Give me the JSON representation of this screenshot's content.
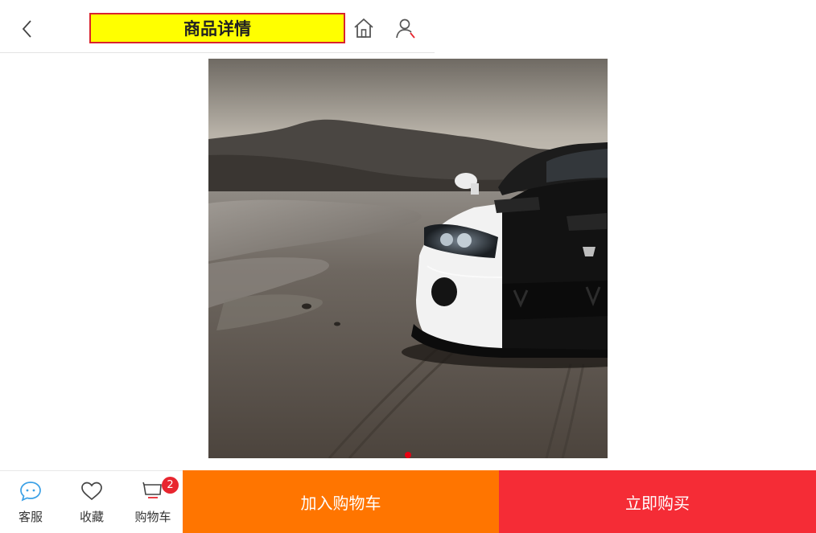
{
  "header": {
    "title": "商品详情",
    "back_icon": "chevron-left-icon",
    "home_icon": "home-icon",
    "user_icon": "user-icon"
  },
  "product": {
    "image": "black-and-white-sports-car-photo",
    "carousel_active_index": 1,
    "carousel_count": 1
  },
  "bottom_bar": {
    "service_label": "客服",
    "favorite_label": "收藏",
    "cart_label": "购物车",
    "cart_count": "2",
    "add_to_cart_label": "加入购物车",
    "buy_now_label": "立即购买"
  },
  "colors": {
    "title_highlight": "#ffff00",
    "title_border": "#d9232d",
    "add_to_cart_bg": "#ff7500",
    "buy_now_bg": "#f52c36",
    "badge_bg": "#e8262f",
    "service_icon": "#3aa0e6"
  }
}
